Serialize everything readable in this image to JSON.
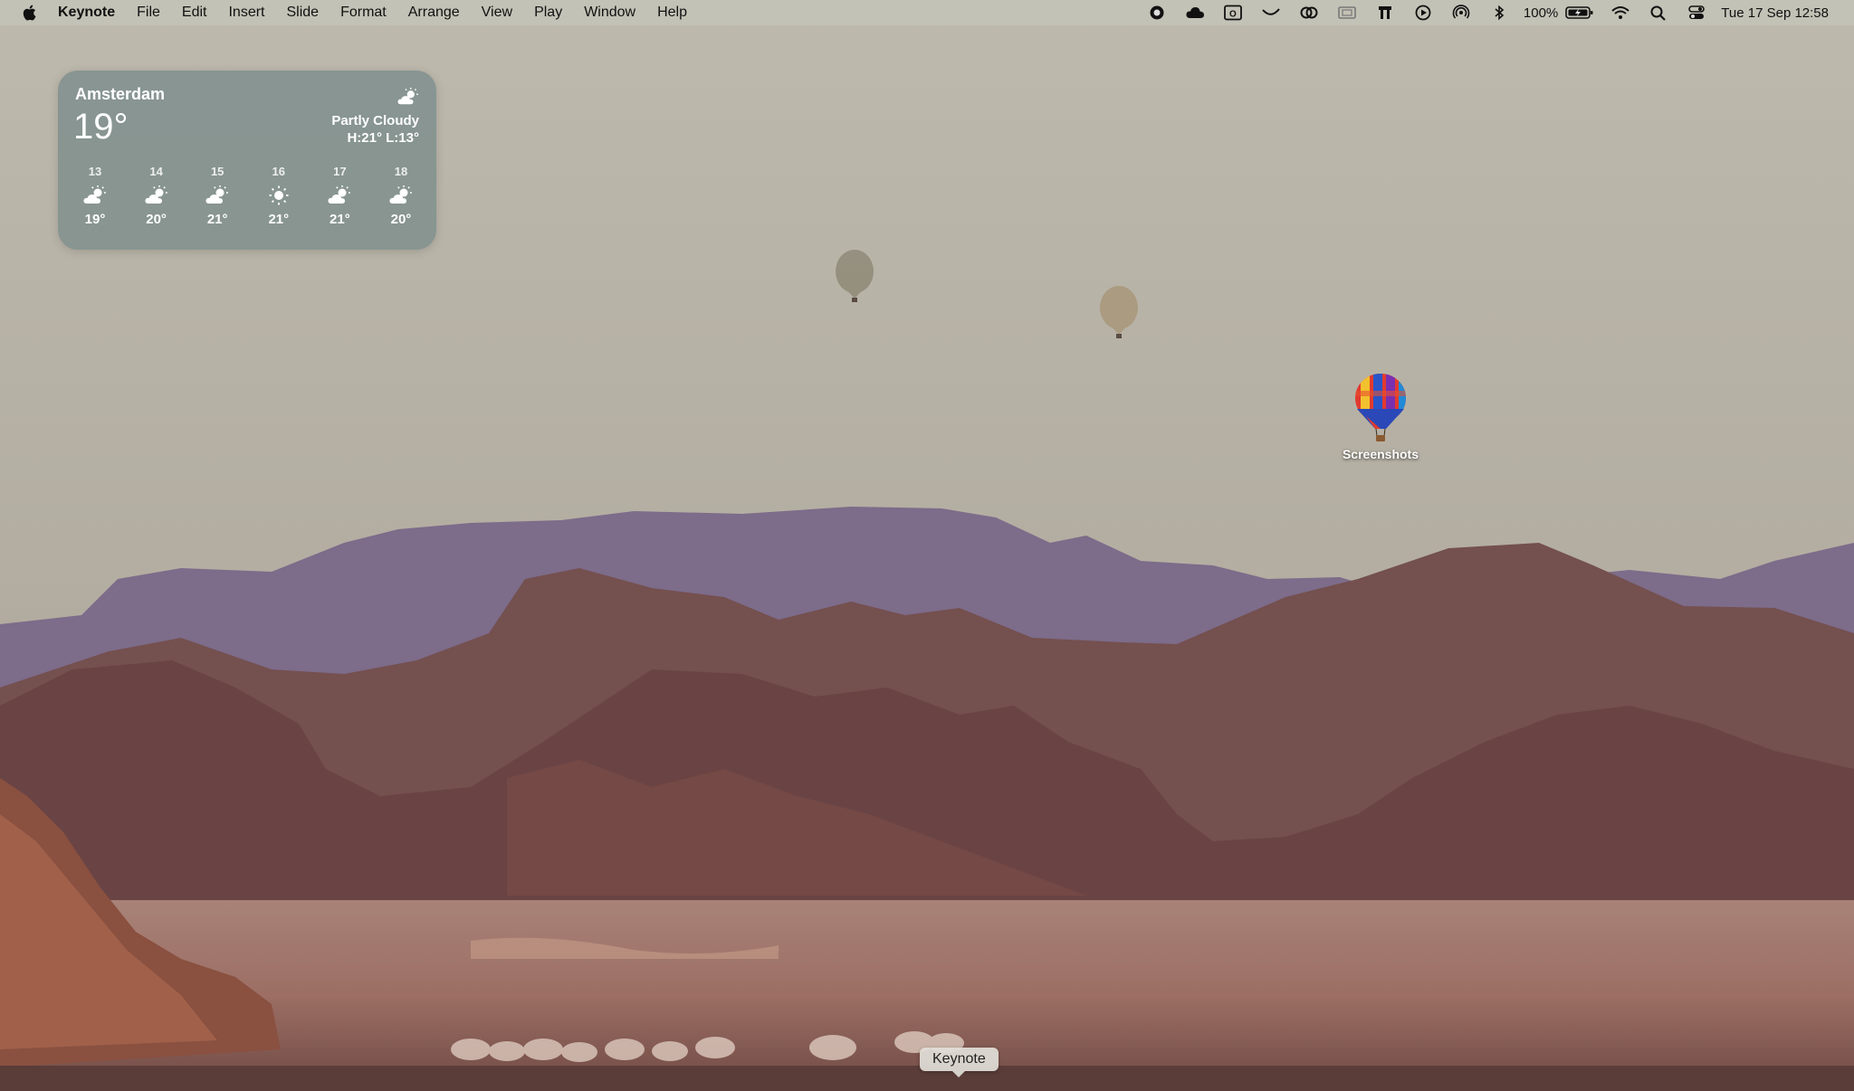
{
  "menubar": {
    "app_name": "Keynote",
    "menus": [
      "File",
      "Edit",
      "Insert",
      "Slide",
      "Format",
      "Arrange",
      "View",
      "Play",
      "Window",
      "Help"
    ],
    "status_icons": [
      "screen-record-icon",
      "cloud-icon",
      "outlook-icon",
      "cursor-icon",
      "creative-cloud-icon",
      "screen-share-icon",
      "tools-icon",
      "play-circle-icon",
      "airdrop-icon",
      "bluetooth-icon",
      "battery-icon",
      "wifi-icon",
      "search-icon",
      "control-center-icon"
    ],
    "battery_percent": "100%",
    "datetime": "Tue 17 Sep  12:58"
  },
  "weather": {
    "city": "Amsterdam",
    "temp": "19°",
    "condition": "Partly Cloudy",
    "hilo": "H:21° L:13°",
    "icon": "partly-cloudy-icon",
    "forecast": [
      {
        "hour": "13",
        "temp": "19°",
        "icon": "partly-cloudy-icon"
      },
      {
        "hour": "14",
        "temp": "20°",
        "icon": "partly-cloudy-icon"
      },
      {
        "hour": "15",
        "temp": "21°",
        "icon": "partly-cloudy-icon"
      },
      {
        "hour": "16",
        "temp": "21°",
        "icon": "sun-icon"
      },
      {
        "hour": "17",
        "temp": "21°",
        "icon": "partly-cloudy-icon"
      },
      {
        "hour": "18",
        "temp": "20°",
        "icon": "partly-cloudy-icon"
      }
    ]
  },
  "desktop": {
    "items": [
      {
        "label": "Screenshots",
        "icon": "hot-air-balloon-icon"
      }
    ]
  },
  "dock": {
    "tooltip": "Keynote"
  },
  "colors": {
    "sky": "#b9b4a6",
    "mountain_far": "#7d6c8a",
    "mountain_near": "#6e4a48",
    "desert": "#9a6a60",
    "widget_bg": "#7a8c8a"
  }
}
